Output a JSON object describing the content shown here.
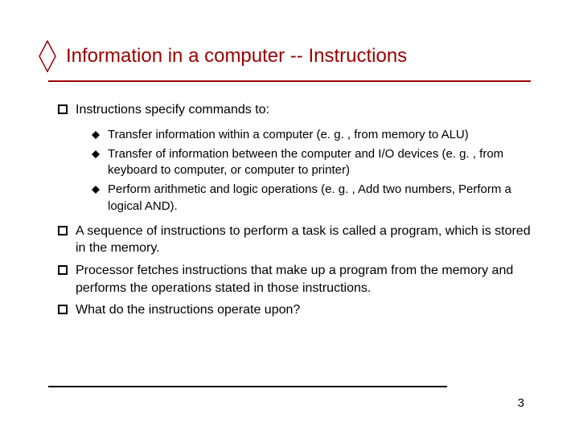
{
  "title": "Information in a computer -- Instructions",
  "bullets": {
    "q1": "Instructions specify commands to:",
    "q1_sub": {
      "a": "Transfer information within a computer (e. g. , from memory to ALU)",
      "b": "Transfer of information between the computer and I/O devices (e. g. , from keyboard to computer, or computer to printer)",
      "c": " Perform arithmetic and logic operations (e. g. , Add two numbers, Perform a logical AND)."
    },
    "q2": "A sequence of instructions to perform a task is called a program, which is stored in the memory.",
    "q3": "Processor fetches instructions that make up a program from the memory and performs the operations stated in those instructions.",
    "q4": "What do the instructions operate upon?"
  },
  "page_number": "3",
  "colors": {
    "title": "#9a0000"
  }
}
